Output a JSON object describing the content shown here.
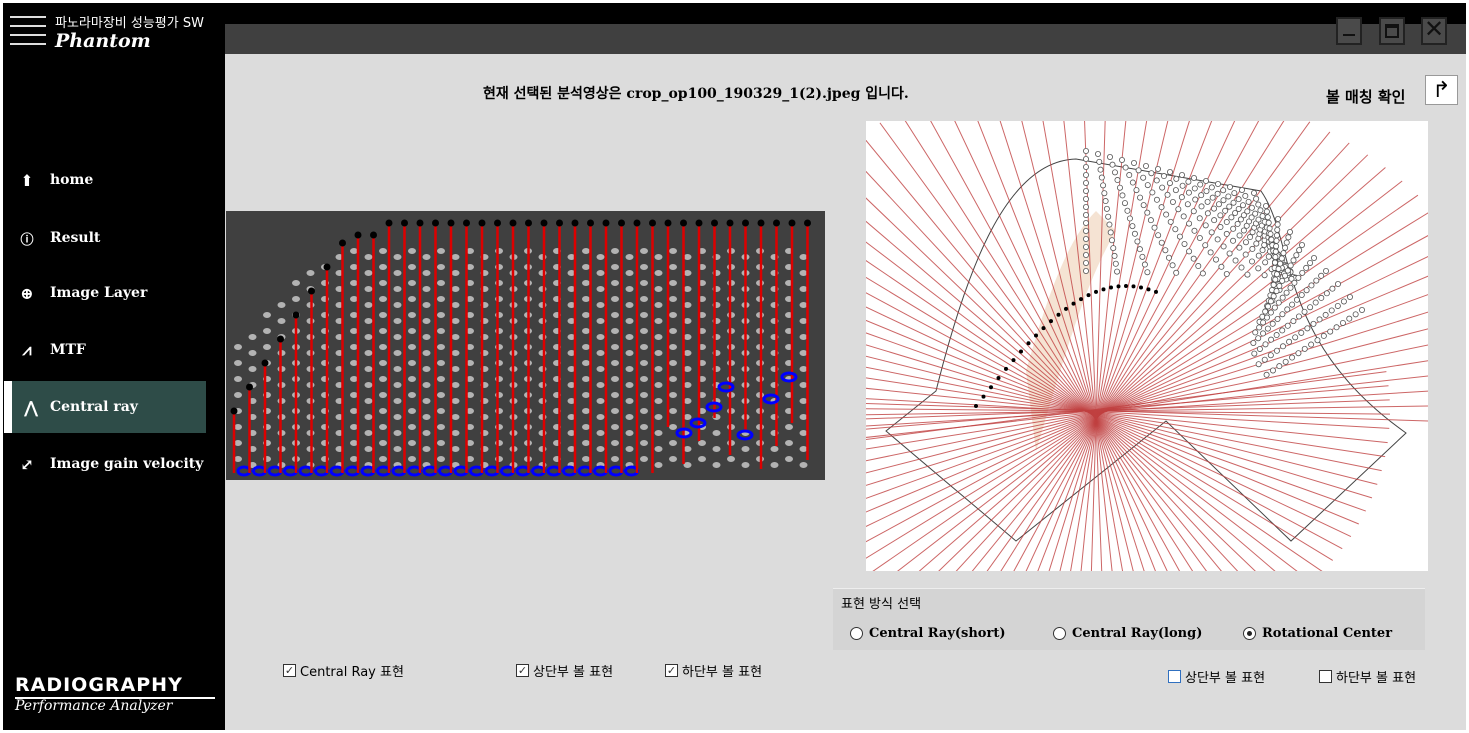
{
  "app": {
    "name": "파노라마장비 성능평가 SW",
    "product": "Phantom",
    "logo_main": "RADIOGRAPHY",
    "logo_sub": "Performance Analyzer"
  },
  "window": {
    "minimize": "minimize",
    "restore": "restore",
    "close": "close"
  },
  "sidebar": {
    "items": [
      {
        "label": "home",
        "icon": "home-icon"
      },
      {
        "label": "Result",
        "icon": "info-icon"
      },
      {
        "label": "Image Layer",
        "icon": "target-icon"
      },
      {
        "label": "MTF",
        "icon": "chart-icon"
      },
      {
        "label": "Central ray",
        "icon": "rays-icon",
        "active": true
      },
      {
        "label": "Image gain velocity",
        "icon": "pin-icon"
      }
    ]
  },
  "main": {
    "headline": "현재 선택된 분석영상은 crop_op100_190329_1(2).jpeg 입니다.",
    "match_label": "볼 매칭 확인",
    "left_checks": [
      {
        "label": "Central Ray 표현",
        "checked": true
      },
      {
        "label": "상단부 볼 표현",
        "checked": true
      },
      {
        "label": "하단부 볼 표현",
        "checked": true
      }
    ],
    "display_group": {
      "title": "표현 방식 선택",
      "options": [
        {
          "label": "Central Ray(short)",
          "selected": false
        },
        {
          "label": "Central Ray(long)",
          "selected": false
        },
        {
          "label": "Rotational Center",
          "selected": true
        }
      ]
    },
    "right_checks": [
      {
        "label": "상단부 볼 표현",
        "checked": false
      },
      {
        "label": "하단부 볼 표현",
        "checked": false
      }
    ]
  },
  "colors": {
    "sidebar": "#000000",
    "active": "#2e4c48",
    "ray": "#cc0000",
    "ball_bottom": "#0000ff"
  }
}
